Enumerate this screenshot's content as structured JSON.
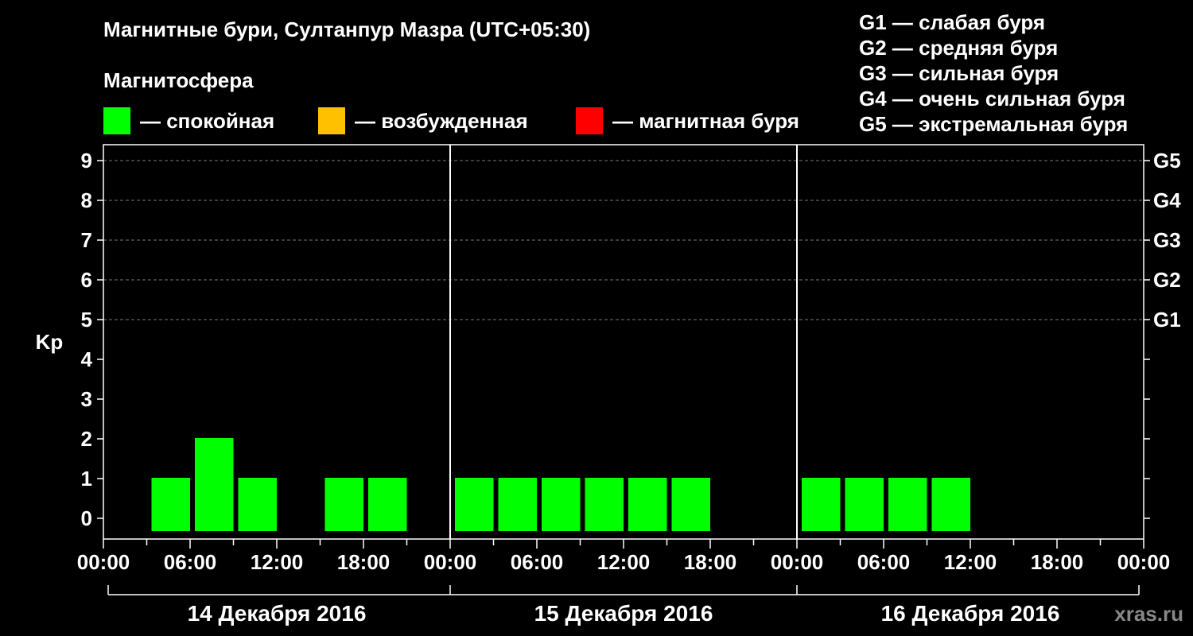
{
  "header": {
    "title": "Магнитные бури, Султанпур Мазра (UTC+05:30)",
    "subtitle": "Магнитосфера"
  },
  "legend": [
    {
      "label": "— спокойная",
      "color": "#00ff00"
    },
    {
      "label": "— возбужденная",
      "color": "#ffc000"
    },
    {
      "label": "— магнитная буря",
      "color": "#ff0000"
    }
  ],
  "g_legend": [
    "G1 — слабая буря",
    "G2 — средняя буря",
    "G3 — сильная буря",
    "G4 — очень сильная буря",
    "G5 — экстремальная буря"
  ],
  "brand": "xras.ru",
  "chart_data": {
    "type": "bar",
    "ylabel": "Kp",
    "ylim": [
      0,
      9
    ],
    "yticks": [
      "0",
      "1",
      "2",
      "3",
      "4",
      "5",
      "6",
      "7",
      "8",
      "9"
    ],
    "right_labels": [
      {
        "y": 5,
        "label": "G1"
      },
      {
        "y": 6,
        "label": "G2"
      },
      {
        "y": 7,
        "label": "G3"
      },
      {
        "y": 8,
        "label": "G4"
      },
      {
        "y": 9,
        "label": "G5"
      }
    ],
    "xticks": [
      "00:00",
      "06:00",
      "12:00",
      "18:00",
      "00:00",
      "06:00",
      "12:00",
      "18:00",
      "00:00",
      "06:00",
      "12:00",
      "18:00",
      "00:00"
    ],
    "days": [
      "14 Декабря 2016",
      "15 Декабря 2016",
      "16 Декабря 2016"
    ],
    "values": [
      null,
      1,
      2,
      1,
      null,
      1,
      1,
      null,
      1,
      1,
      1,
      1,
      1,
      1,
      null,
      null,
      1,
      1,
      1,
      1,
      null,
      null,
      null,
      null
    ],
    "bar_color": "#00ff00",
    "grid": true
  }
}
